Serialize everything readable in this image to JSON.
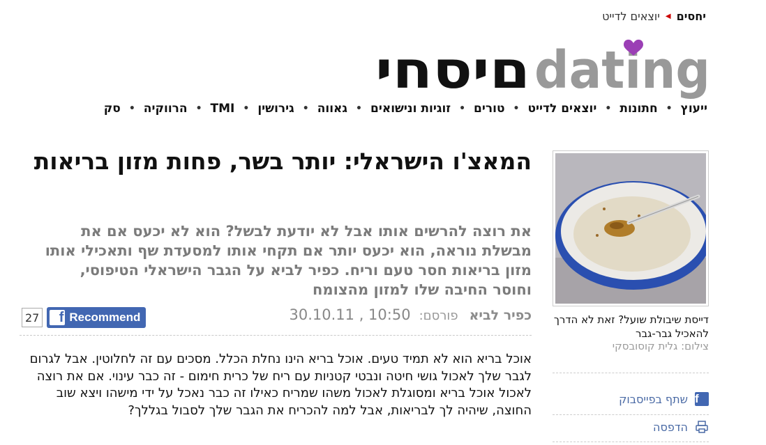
{
  "breadcrumb": {
    "home": "יחסים",
    "current": "יוצאים לדייט"
  },
  "logo": {
    "latin": "dating",
    "hebrew": "יחסים"
  },
  "nav": {
    "items": [
      "ייעוץ",
      "חתונות",
      "יוצאים לדייט",
      "טורים",
      "זוגיות ונישואים",
      "גאווה",
      "גירושין",
      "TMI",
      "הרווקיה",
      "סק"
    ]
  },
  "article": {
    "headline": "המאצ'ו הישראלי: יותר בשר, פחות מזון בריאות",
    "subtitle": "את רוצה להרשים אותו אבל לא יודעת לבשל? הוא לא יכעס אם את מבשלת נוראה, הוא יכעס יותר אם תקחי אותו למסעדת שף ותאכילי אותו מזון בריאות חסר טעם וריח. כפיר לביא על הגבר הישראלי הטיפוסי, וחוסר החיבה שלו למזון מהצומח",
    "author": "כפיר לביא",
    "posted_label": "פורסם:",
    "date": "30.10.11 , 10:50",
    "body": "אוכל בריא הוא לא תמיד טעים. אוכל בריא הינו נחלת הכלל. מסכים עם זה לחלוטין. אבל לגרום לגבר שלך לאכול גושי חיטה ונבטי קטניות עם ריח של כרית חימום - זה כבר עינוי. אם את רוצה לאכול אוכל בריא ומסוגלת לאכול משהו שמריח כאילו זה כבר נאכל על ידי מישהו ויצא שוב החוצה, שיהיה לך לבריאות, אבל למה להכריח את הגבר שלך לסבול בגללך?"
  },
  "facebook": {
    "recommend_label": "Recommend",
    "count": "27",
    "f_glyph": "f"
  },
  "sidebar": {
    "caption": "דייסת שיבולת שועל? זאת לא הדרך להאכיל גבר-גבר",
    "credit": "צילום: גלית קוסובסקי",
    "share_facebook": "שתף בפייסבוק",
    "print": "הדפסה"
  },
  "colors": {
    "logo_gray": "#999999",
    "logo_heart": "#9b3fb5",
    "fb_blue": "#4267b2",
    "share_link": "#4a6aa5"
  }
}
